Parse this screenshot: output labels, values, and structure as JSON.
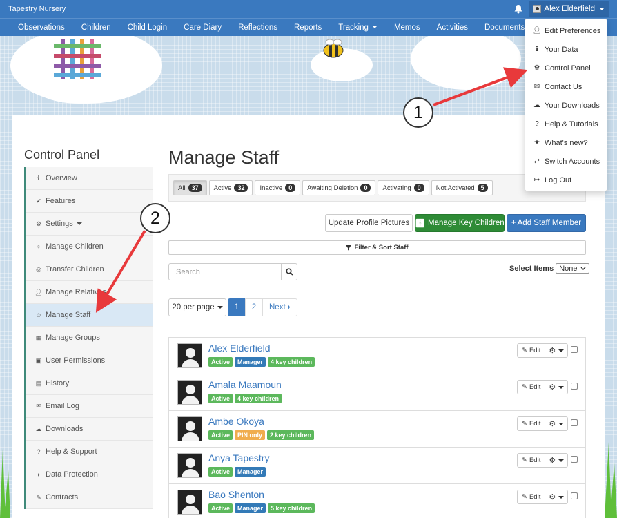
{
  "topbar": {
    "brand": "Tapestry Nursery",
    "user_name": "Alex Elderfield"
  },
  "nav": [
    "Observations",
    "Children",
    "Child Login",
    "Care Diary",
    "Reflections",
    "Reports",
    "Tracking",
    "Memos",
    "Activities",
    "Documents"
  ],
  "dropdown": [
    {
      "label": "Edit Preferences",
      "icon": "user-icon"
    },
    {
      "label": "Your Data",
      "icon": "info-icon"
    },
    {
      "label": "Control Panel",
      "icon": "gear-icon"
    },
    {
      "label": "Contact Us",
      "icon": "envelope-icon"
    },
    {
      "label": "Your Downloads",
      "icon": "cloud-download-icon"
    },
    {
      "label": "Help & Tutorials",
      "icon": "question-icon"
    },
    {
      "label": "What's new?",
      "icon": "star-icon"
    },
    {
      "label": "Switch Accounts",
      "icon": "switch-icon"
    },
    {
      "label": "Log Out",
      "icon": "logout-icon"
    }
  ],
  "sidebar": {
    "title": "Control Panel",
    "items": [
      {
        "label": "Overview",
        "icon": "info-icon"
      },
      {
        "label": "Features",
        "icon": "check-icon"
      },
      {
        "label": "Settings",
        "icon": "gear-icon"
      },
      {
        "label": "Manage Children",
        "icon": "child-icon"
      },
      {
        "label": "Transfer Children",
        "icon": "transfer-icon"
      },
      {
        "label": "Manage Relatives",
        "icon": "user-icon"
      },
      {
        "label": "Manage Staff",
        "icon": "users-icon"
      },
      {
        "label": "Manage Groups",
        "icon": "grid-icon"
      },
      {
        "label": "User Permissions",
        "icon": "lock-icon"
      },
      {
        "label": "History",
        "icon": "calendar-icon"
      },
      {
        "label": "Email Log",
        "icon": "envelope-icon"
      },
      {
        "label": "Downloads",
        "icon": "cloud-download-icon"
      },
      {
        "label": "Help & Support",
        "icon": "question-icon"
      },
      {
        "label": "Data Protection",
        "icon": "shield-icon"
      },
      {
        "label": "Contracts",
        "icon": "pencil-icon"
      }
    ]
  },
  "main": {
    "title": "Manage Staff",
    "filters": [
      {
        "label": "All",
        "count": "37"
      },
      {
        "label": "Active",
        "count": "32"
      },
      {
        "label": "Inactive",
        "count": "0"
      },
      {
        "label": "Awaiting Deletion",
        "count": "0"
      },
      {
        "label": "Activating",
        "count": "0"
      },
      {
        "label": "Not Activated",
        "count": "5"
      }
    ],
    "update_pictures": "Update Profile Pictures",
    "manage_key_children": "Manage Key Children",
    "add_staff": "Add Staff Member",
    "filter_sort": "Filter & Sort Staff",
    "search_placeholder": "Search",
    "select_items_label": "Select Items",
    "select_items_value": "None",
    "per_page": "20 per page",
    "pages": [
      "1",
      "2"
    ],
    "next_label": "Next"
  },
  "staff": [
    {
      "name": "Alex Elderfield",
      "badges": [
        {
          "text": "Active",
          "color": "green"
        },
        {
          "text": "Manager",
          "color": "blue"
        },
        {
          "text": "4 key children",
          "color": "green"
        }
      ]
    },
    {
      "name": "Amala Maamoun",
      "badges": [
        {
          "text": "Active",
          "color": "green"
        },
        {
          "text": "4 key children",
          "color": "green"
        }
      ]
    },
    {
      "name": "Ambe Okoya",
      "badges": [
        {
          "text": "Active",
          "color": "green"
        },
        {
          "text": "PIN only",
          "color": "orange"
        },
        {
          "text": "2 key children",
          "color": "green"
        }
      ]
    },
    {
      "name": "Anya Tapestry",
      "badges": [
        {
          "text": "Active",
          "color": "green"
        },
        {
          "text": "Manager",
          "color": "blue"
        }
      ]
    },
    {
      "name": "Bao Shenton",
      "badges": [
        {
          "text": "Active",
          "color": "green"
        },
        {
          "text": "Manager",
          "color": "blue"
        },
        {
          "text": "5 key children",
          "color": "green"
        }
      ]
    }
  ],
  "edit_label": "Edit",
  "callouts": [
    "1",
    "2"
  ],
  "colors": {
    "primary": "#3a79bf",
    "success": "#2e8b36",
    "annotation_arrow": "#e8393b"
  }
}
